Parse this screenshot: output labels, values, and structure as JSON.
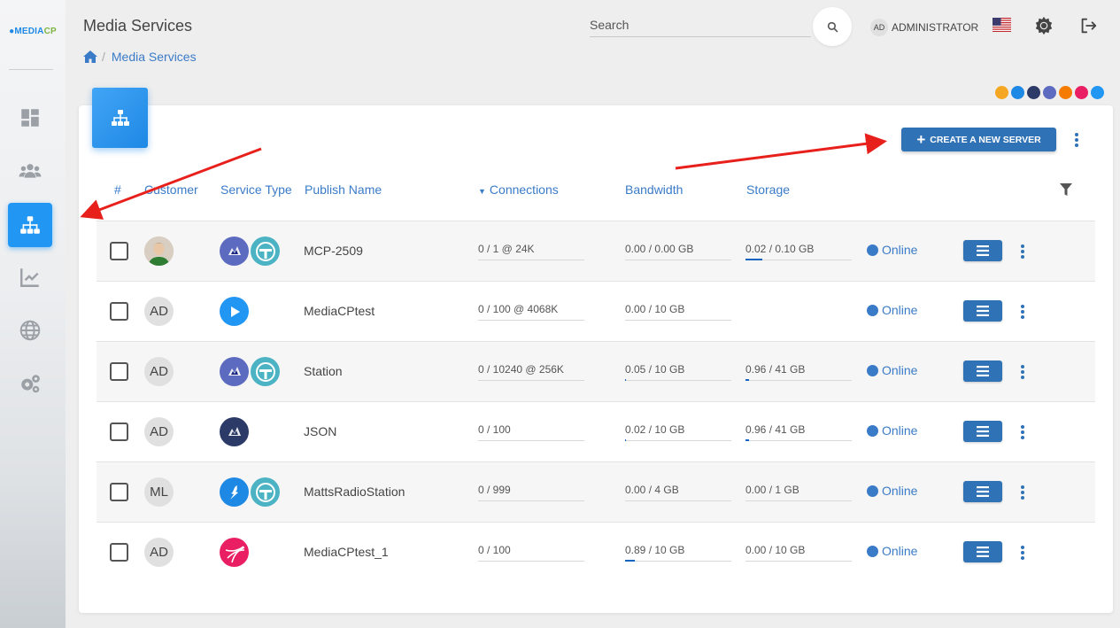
{
  "app": {
    "logo_prefix": "MEDIA",
    "logo_suffix": "CP"
  },
  "header": {
    "title": "Media Services",
    "breadcrumb_current": "Media Services",
    "search_placeholder": "Search",
    "user_initials": "AD",
    "user_name": "ADMINISTRATOR"
  },
  "sidebar": {
    "items": [
      {
        "name": "dashboard",
        "icon": "dashboard-icon",
        "active": false
      },
      {
        "name": "customers",
        "icon": "users-icon",
        "active": false
      },
      {
        "name": "media-services",
        "icon": "sitemap-icon",
        "active": true
      },
      {
        "name": "reports",
        "icon": "chart-icon",
        "active": false
      },
      {
        "name": "network",
        "icon": "globe-icon",
        "active": false
      },
      {
        "name": "settings",
        "icon": "gears-icon",
        "active": false
      }
    ]
  },
  "toolbar": {
    "create_label": "CREATE A NEW SERVER"
  },
  "table": {
    "headers": {
      "num": "#",
      "customer": "Customer",
      "service_type": "Service Type",
      "publish_name": "Publish Name",
      "connections": "Connections",
      "bandwidth": "Bandwidth",
      "storage": "Storage"
    },
    "rows": [
      {
        "customer": "",
        "services": [
          "shoutcast",
          "icecast"
        ],
        "publish_name": "MCP-2509",
        "connections": "0 / 1 @ 24K",
        "bandwidth": "0.00 / 0.00 GB",
        "bandwidth_pct": 0,
        "storage": "0.02 / 0.10 GB",
        "storage_pct": 16,
        "status": "Online"
      },
      {
        "customer": "AD",
        "services": [
          "video"
        ],
        "publish_name": "MediaCPtest",
        "connections": "0 / 100 @ 4068K",
        "bandwidth": "0.00 / 10 GB",
        "bandwidth_pct": 0,
        "storage": "",
        "storage_pct": 0,
        "status": "Online"
      },
      {
        "customer": "AD",
        "services": [
          "shoutcast",
          "icecast"
        ],
        "publish_name": "Station",
        "connections": "0 / 10240 @ 256K",
        "bandwidth": "0.05 / 10 GB",
        "bandwidth_pct": 1,
        "storage": "0.96 / 41 GB",
        "storage_pct": 3,
        "status": "Online"
      },
      {
        "customer": "AD",
        "services": [
          "shoutcast-dark"
        ],
        "publish_name": "JSON",
        "connections": "0 / 100",
        "bandwidth": "0.02 / 10 GB",
        "bandwidth_pct": 1,
        "storage": "0.96 / 41 GB",
        "storage_pct": 3,
        "status": "Online"
      },
      {
        "customer": "ML",
        "services": [
          "flash",
          "icecast"
        ],
        "publish_name": "MattsRadioStation",
        "connections": "0 / 999",
        "bandwidth": "0.00 / 4 GB",
        "bandwidth_pct": 0,
        "storage": "0.00 / 1 GB",
        "storage_pct": 0,
        "status": "Online"
      },
      {
        "customer": "AD",
        "services": [
          "ball"
        ],
        "publish_name": "MediaCPtest_1",
        "connections": "0 / 100",
        "bandwidth": "0.89 / 10 GB",
        "bandwidth_pct": 9,
        "storage": "0.00 / 10 GB",
        "storage_pct": 0,
        "status": "Online"
      }
    ]
  },
  "colors": {
    "accent": "#2196f3",
    "link": "#3a7bc8",
    "button": "#2f72b6",
    "annotation_arrow": "#e8201c"
  }
}
